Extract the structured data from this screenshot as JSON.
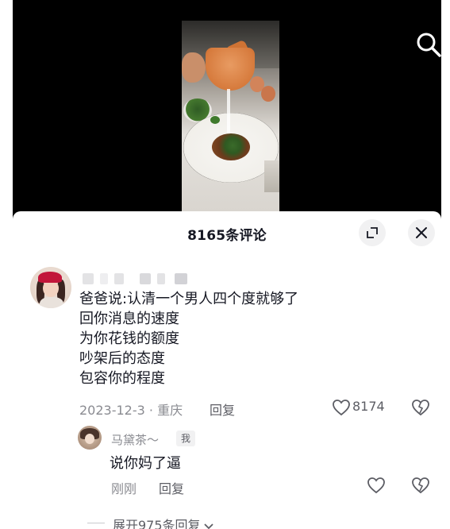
{
  "video": {
    "search_icon": "search-icon"
  },
  "sheet": {
    "title": "8165条评论",
    "expand_icon": "expand-icon",
    "close_icon": "close-icon"
  },
  "comment": {
    "author": "",
    "lines": [
      "爸爸说:认清一个男人四个度就够了",
      "回你消息的速度",
      "为你花钱的额度",
      "吵架后的态度",
      "包容你的程度"
    ],
    "date_location": "2023-12-3 · 重庆",
    "reply_label": "回复",
    "like_count": "8174",
    "like_icon": "heart-outline-icon",
    "dislike_icon": "broken-heart-icon"
  },
  "reply": {
    "author": "马黛茶～",
    "badge": "我",
    "text": "说你妈了逼",
    "time": "刚刚",
    "reply_label": "回复",
    "like_icon": "heart-outline-icon",
    "dislike_icon": "broken-heart-icon"
  },
  "expand_replies": {
    "label": "展开975条回复"
  },
  "colors": {
    "text_primary": "#161823",
    "text_secondary": "#8a8b91",
    "button_bg": "#f1f1f2",
    "video_bg": "#000000"
  }
}
